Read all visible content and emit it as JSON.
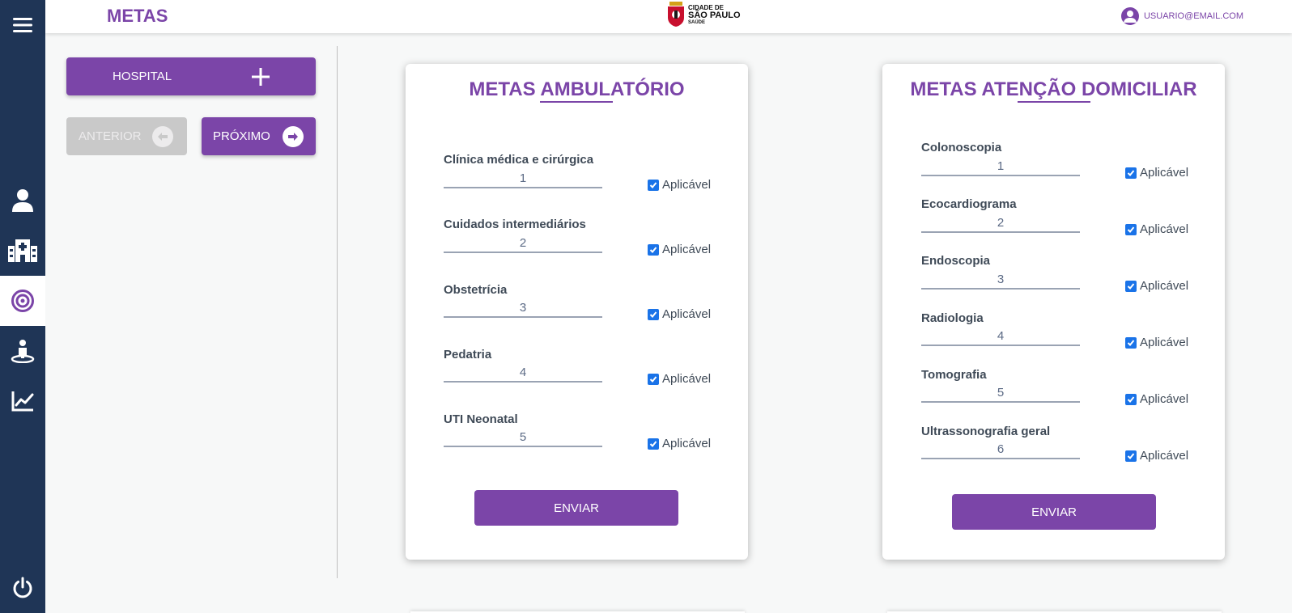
{
  "header": {
    "title": "METAS",
    "logo": {
      "line1": "CIDADE DE",
      "line2": "SÃO PAULO",
      "line3": "SAÚDE"
    },
    "user_email": "USUARIO@EMAIL.COM"
  },
  "sidebar": {
    "items": [
      {
        "name": "menu",
        "icon": "hamburger-icon"
      },
      {
        "name": "users",
        "icon": "user-icon"
      },
      {
        "name": "hospitals",
        "icon": "hospital-icon"
      },
      {
        "name": "metas",
        "icon": "target-icon",
        "active": true
      },
      {
        "name": "people",
        "icon": "person-location-icon"
      },
      {
        "name": "charts",
        "icon": "chart-line-icon"
      },
      {
        "name": "logout",
        "icon": "power-icon"
      }
    ]
  },
  "actions": {
    "hospital_label": "HOSPITAL",
    "anterior_label": "ANTERIOR",
    "proximo_label": "PRÓXIMO"
  },
  "colors": {
    "primary": "#7b45a8",
    "sidebar": "#1f3556",
    "checkbox": "#1a73e8"
  },
  "cards": [
    {
      "title": "METAS AMBULATÓRIO",
      "submit_label": "ENVIAR",
      "fields": [
        {
          "label": "Clínica médica e cirúrgica",
          "value": "1",
          "check_label": "Aplicável",
          "checked": true
        },
        {
          "label": "Cuidados intermediários",
          "value": "2",
          "check_label": "Aplicável",
          "checked": true
        },
        {
          "label": "Obstetrícia",
          "value": "3",
          "check_label": "Aplicável",
          "checked": true
        },
        {
          "label": "Pedatria",
          "value": "4",
          "check_label": "Aplicável",
          "checked": true
        },
        {
          "label": "UTI Neonatal",
          "value": "5",
          "check_label": "Aplicável",
          "checked": true
        }
      ]
    },
    {
      "title": "METAS ATENÇÃO DOMICILIAR",
      "submit_label": "ENVIAR",
      "fields": [
        {
          "label": "Colonoscopia",
          "value": "1",
          "check_label": "Aplicável",
          "checked": true
        },
        {
          "label": "Ecocardiograma",
          "value": "2",
          "check_label": "Aplicável",
          "checked": true
        },
        {
          "label": "Endoscopia",
          "value": "3",
          "check_label": "Aplicável",
          "checked": true
        },
        {
          "label": "Radiologia",
          "value": "4",
          "check_label": "Aplicável",
          "checked": true
        },
        {
          "label": "Tomografia",
          "value": "5",
          "check_label": "Aplicável",
          "checked": true
        },
        {
          "label": "Ultrassonografia geral",
          "value": "6",
          "check_label": "Aplicável",
          "checked": true
        }
      ]
    }
  ]
}
